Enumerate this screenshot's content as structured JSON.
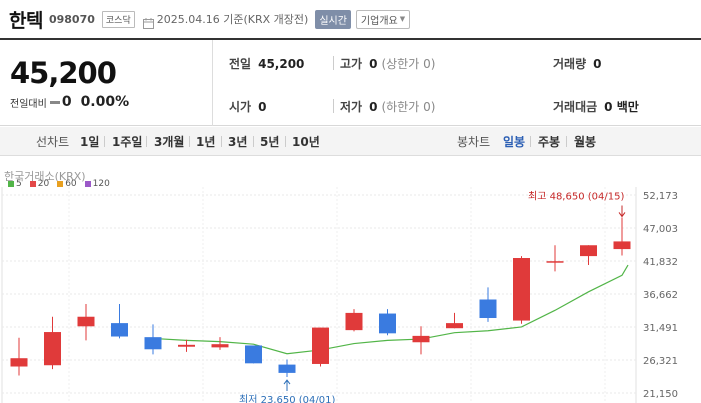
{
  "header": {
    "name": "한텍",
    "code": "098070",
    "market": "코스닥",
    "date": "2025.04.16",
    "basis": "기준(KRX 개장전)",
    "realtime": "실시간",
    "company_info": "기업개요"
  },
  "summary": {
    "price": "45,200",
    "change_label": "전일대비",
    "change_value": "0",
    "change_pct": "0.00%",
    "prev_close_label": "전일",
    "prev_close": "45,200",
    "high_label": "고가",
    "high": "0",
    "high_limit": "(상한가 0)",
    "volume_label": "거래량",
    "volume": "0",
    "open_label": "시가",
    "open": "0",
    "low_label": "저가",
    "low": "0",
    "low_limit": "(하한가 0)",
    "amount_label": "거래대금",
    "amount": "0 백만"
  },
  "toolbar": {
    "line_label": "선차트",
    "line_periods": [
      "1일",
      "1주일",
      "3개월",
      "1년",
      "3년",
      "5년",
      "10년"
    ],
    "candle_label": "봉차트",
    "candle_periods": [
      "일봉",
      "주봉",
      "월봉"
    ],
    "active_candle": "일봉"
  },
  "chart": {
    "source": "한국거래소(KRX)",
    "legend": [
      {
        "label": "5",
        "color": "#52b548"
      },
      {
        "label": "20",
        "color": "#e34848"
      },
      {
        "label": "60",
        "color": "#e8a020"
      },
      {
        "label": "120",
        "color": "#9b59c8"
      }
    ],
    "high_note": "최고 48,650 (04/15)",
    "low_note": "최저 23,650 (04/01)"
  },
  "chart_data": {
    "type": "candlestick",
    "y_ticks": [
      "52,173",
      "47,003",
      "41,832",
      "36,662",
      "31,491",
      "26,321",
      "21,150"
    ],
    "ylim": [
      21150,
      52173
    ],
    "up_color": "#e03a3a",
    "down_color": "#3a7be0",
    "ma_color": "#52b548",
    "candles": [
      {
        "o": 25300,
        "h": 29800,
        "l": 23900,
        "c": 26600
      },
      {
        "o": 25500,
        "h": 33100,
        "l": 24900,
        "c": 30700
      },
      {
        "o": 31600,
        "h": 35100,
        "l": 29400,
        "c": 33100
      },
      {
        "o": 32100,
        "h": 35100,
        "l": 29700,
        "c": 30000
      },
      {
        "o": 29900,
        "h": 31900,
        "l": 27200,
        "c": 28000
      },
      {
        "o": 28400,
        "h": 29500,
        "l": 27600,
        "c": 28700
      },
      {
        "o": 28300,
        "h": 29900,
        "l": 27900,
        "c": 28800
      },
      {
        "o": 28600,
        "h": 28600,
        "l": 25800,
        "c": 25800
      },
      {
        "o": 25600,
        "h": 26400,
        "l": 23650,
        "c": 24300
      },
      {
        "o": 25700,
        "h": 31400,
        "l": 25300,
        "c": 31400
      },
      {
        "o": 31000,
        "h": 34300,
        "l": 30800,
        "c": 33700
      },
      {
        "o": 33600,
        "h": 34300,
        "l": 30200,
        "c": 30500
      },
      {
        "o": 29100,
        "h": 31600,
        "l": 27200,
        "c": 30100
      },
      {
        "o": 31300,
        "h": 33700,
        "l": 31300,
        "c": 32100
      },
      {
        "o": 35800,
        "h": 37700,
        "l": 32300,
        "c": 32900
      },
      {
        "o": 32500,
        "h": 42600,
        "l": 32000,
        "c": 42300
      },
      {
        "o": 41800,
        "h": 44300,
        "l": 40200,
        "c": 41800
      },
      {
        "o": 42600,
        "h": 44300,
        "l": 41200,
        "c": 44300
      },
      {
        "o": 43700,
        "h": 48650,
        "l": 42700,
        "c": 44900
      }
    ],
    "ma5": [
      null,
      null,
      null,
      null,
      null,
      null,
      29700,
      29600,
      29500,
      28700,
      28500,
      28100,
      28700,
      29100,
      29700,
      30800,
      33200,
      35100,
      37000,
      39100,
      41000
    ]
  }
}
